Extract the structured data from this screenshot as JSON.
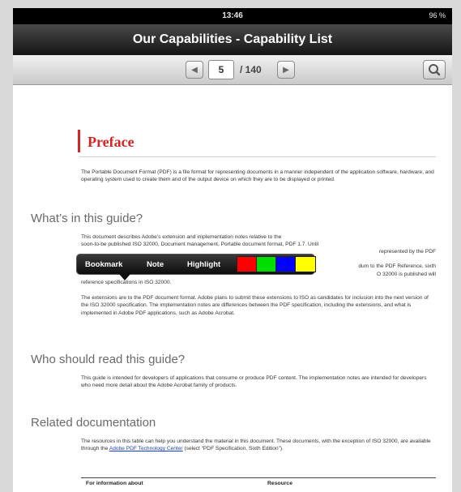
{
  "status": {
    "time": "13:46",
    "battery": "96 %"
  },
  "title": "Our Capabilities - Capability List",
  "toolbar": {
    "page_current": "5",
    "page_total": "/ 140"
  },
  "icons": {
    "prev": "chevron-left-icon",
    "next": "chevron-right-icon",
    "search": "search-icon"
  },
  "document": {
    "heading": "Preface",
    "intro": "The Portable Document Format (PDF) is a file format for representing documents in a manner independent of the application software, hardware, and operating system used to create them and of the output device on which they are to be displayed or printed.",
    "sections": [
      {
        "title": "What’s in this guide?"
      },
      {
        "title": "Who should read this guide?"
      },
      {
        "title": "Related documentation"
      }
    ],
    "guide_para1_line1": "This document describes Adobe’s extension and implementation notes relative to the",
    "guide_para1_line2": "soon-to-be published ISO 32000, Document management, Portable document format, PDF 1.7. Until",
    "guide_para1_line3_right": "represented by the PDF",
    "guide_para1_line4_right": "dum to the PDF Reference, sixth",
    "guide_para1_line5_right": "O 32000 is published will",
    "guide_para1_line6": "reference specifications in ISO 32000.",
    "guide_para2": "The extensions are to the PDF document format. Adobe plans to submit these extensions to ISO as candidates for inclusion into the next version of the ISO 32000 specification. The implementation notes are differences between the PDF specification, including the extensions, and what is implemented in Adobe PDF applications, such as Adobe Acrobat.",
    "who_para": "This guide is intended for developers of applications that consume or produce PDF content. The implementation notes are intended for developers who need more detail about the Adobe Acrobat family of products.",
    "related_para_a": "The resources in this table can help you understand the material in this document. These documents, with the exception of ISO 32000, are available through the ",
    "related_link": "Adobe PDF Technology Center",
    "related_para_b": " (select “PDF Specification, Sixth Edition”).",
    "table_headers": [
      "For information about",
      "Resource"
    ]
  },
  "popup": {
    "items": [
      "Bookmark",
      "Note",
      "Highlight"
    ],
    "colors": [
      "#ff0000",
      "#00dd00",
      "#0000ff",
      "#ffff00"
    ]
  }
}
